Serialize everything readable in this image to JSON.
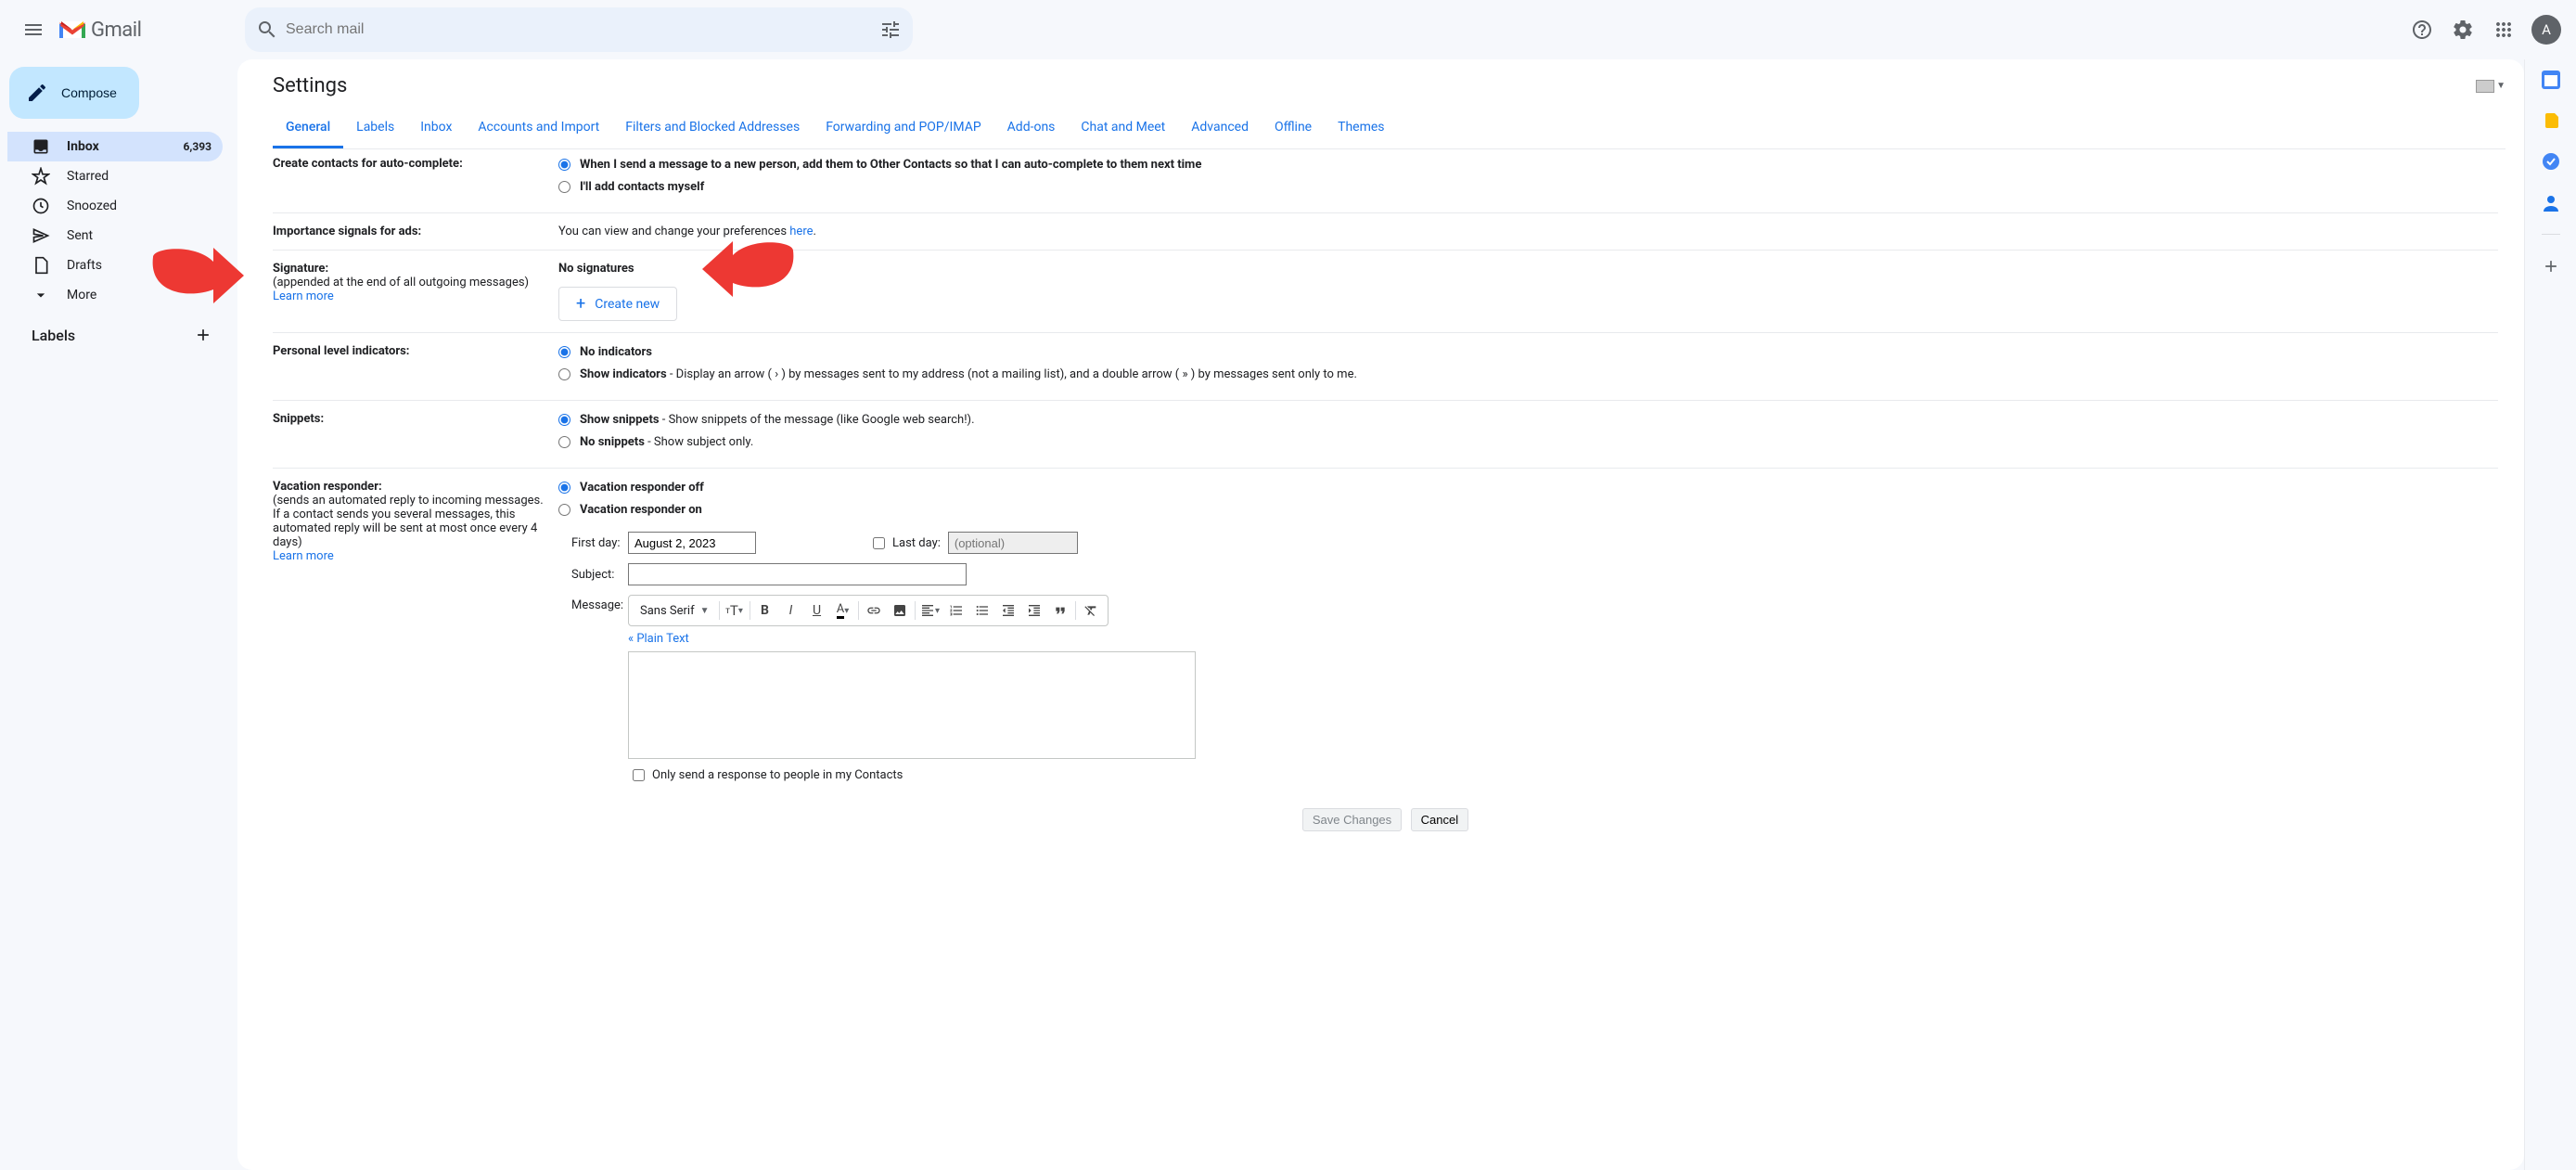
{
  "header": {
    "logo_text": "Gmail",
    "search_placeholder": "Search mail",
    "avatar_initial": "A"
  },
  "sidebar": {
    "compose_label": "Compose",
    "items": [
      {
        "icon": "inbox",
        "label": "Inbox",
        "count": "6,393"
      },
      {
        "icon": "star",
        "label": "Starred",
        "count": ""
      },
      {
        "icon": "snooze",
        "label": "Snoozed",
        "count": ""
      },
      {
        "icon": "send",
        "label": "Sent",
        "count": ""
      },
      {
        "icon": "draft",
        "label": "Drafts",
        "count": ""
      },
      {
        "icon": "more",
        "label": "More",
        "count": ""
      }
    ],
    "labels_header": "Labels"
  },
  "main": {
    "title": "Settings",
    "tabs": [
      "General",
      "Labels",
      "Inbox",
      "Accounts and Import",
      "Filters and Blocked Addresses",
      "Forwarding and POP/IMAP",
      "Add-ons",
      "Chat and Meet",
      "Advanced",
      "Offline",
      "Themes"
    ]
  },
  "settings": {
    "autocomplete": {
      "label": "Create contacts for auto-complete:",
      "opt1": "When I send a message to a new person, add them to Other Contacts so that I can auto-complete to them next time",
      "opt2": "I'll add contacts myself"
    },
    "importance": {
      "label": "Importance signals for ads:",
      "text_pre": "You can view and change your preferences ",
      "link": "here",
      "text_post": "."
    },
    "signature": {
      "label": "Signature:",
      "sublabel": "(appended at the end of all outgoing messages)",
      "learn_more": "Learn more",
      "no_sig": "No signatures",
      "create_new": "Create new"
    },
    "personal": {
      "label": "Personal level indicators:",
      "opt1": "No indicators",
      "opt2_bold": "Show indicators",
      "opt2_rest": " - Display an arrow ( › ) by messages sent to my address (not a mailing list), and a double arrow ( » ) by messages sent only to me."
    },
    "snippets": {
      "label": "Snippets:",
      "opt1_bold": "Show snippets",
      "opt1_rest": " - Show snippets of the message (like Google web search!).",
      "opt2_bold": "No snippets",
      "opt2_rest": " - Show subject only."
    },
    "vacation": {
      "label": "Vacation responder:",
      "sublabel": "(sends an automated reply to incoming messages. If a contact sends you several messages, this automated reply will be sent at most once every 4 days)",
      "learn_more": "Learn more",
      "opt_off": "Vacation responder off",
      "opt_on": "Vacation responder on",
      "first_day_label": "First day:",
      "first_day_value": "August 2, 2023",
      "last_day_label": "Last day:",
      "last_day_placeholder": "(optional)",
      "subject_label": "Subject:",
      "message_label": "Message:",
      "font_name": "Sans Serif",
      "plain_text": "« Plain Text",
      "contacts_only": "Only send a response to people in my Contacts"
    },
    "save": "Save Changes",
    "cancel": "Cancel"
  }
}
